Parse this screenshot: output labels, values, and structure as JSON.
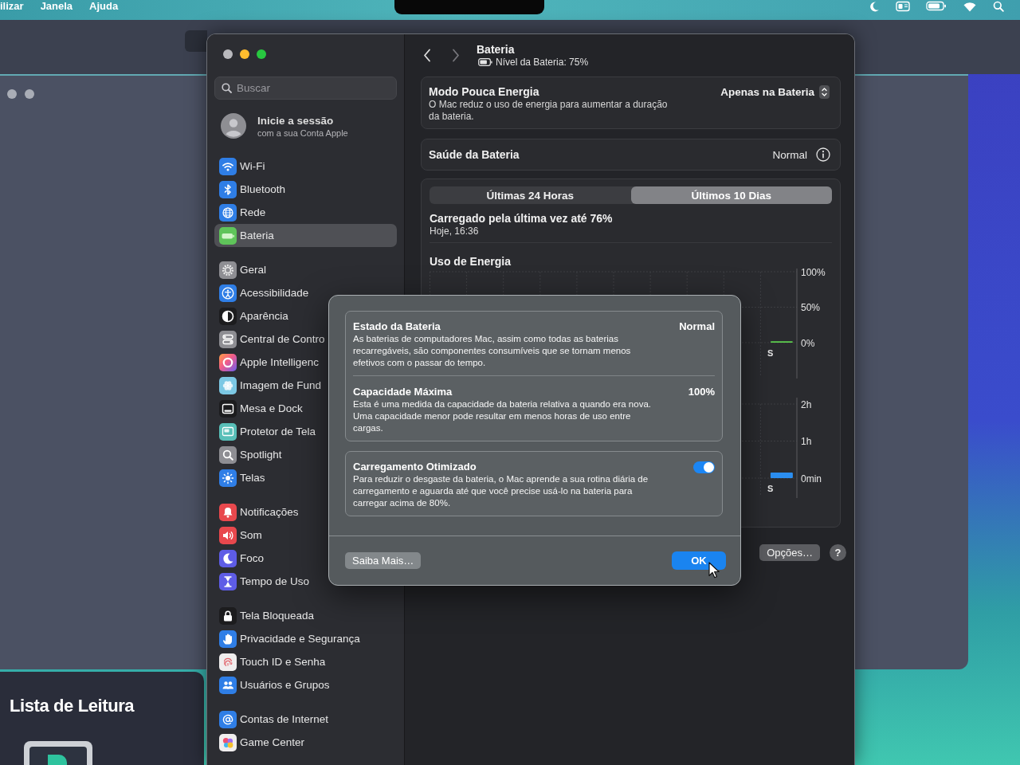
{
  "menu_bar": {
    "menus": [
      "ilizar",
      "Janela",
      "Ajuda"
    ]
  },
  "reading_list": {
    "title": "Lista de Leitura"
  },
  "settings": {
    "traffic_lights": [
      {
        "kind": "close",
        "disabled": true
      },
      {
        "kind": "minimize",
        "disabled": false
      },
      {
        "kind": "zoom",
        "disabled": false
      }
    ],
    "sidebar": {
      "search": {
        "placeholder": "Buscar"
      },
      "account": {
        "title": "Inicie a sessão",
        "subtitle": "com a sua Conta Apple"
      },
      "groups": [
        {
          "items": [
            {
              "label": "Wi-Fi",
              "selected": false
            },
            {
              "label": "Bluetooth",
              "selected": false
            },
            {
              "label": "Rede",
              "selected": false
            },
            {
              "label": "Bateria",
              "selected": true
            }
          ]
        },
        {
          "items": [
            {
              "label": "Geral",
              "selected": false
            },
            {
              "label": "Acessibilidade",
              "selected": false
            },
            {
              "label": "Aparência",
              "selected": false
            },
            {
              "label": "Central de Contro",
              "selected": false
            },
            {
              "label": "Apple Intelligenc",
              "selected": false
            },
            {
              "label": "Imagem de Fund",
              "selected": false
            },
            {
              "label": "Mesa e Dock",
              "selected": false
            },
            {
              "label": "Protetor de Tela",
              "selected": false
            },
            {
              "label": "Spotlight",
              "selected": false
            },
            {
              "label": "Telas",
              "selected": false
            }
          ]
        },
        {
          "items": [
            {
              "label": "Notificações",
              "selected": false
            },
            {
              "label": "Som",
              "selected": false
            },
            {
              "label": "Foco",
              "selected": false
            },
            {
              "label": "Tempo de Uso",
              "selected": false
            }
          ]
        },
        {
          "items": [
            {
              "label": "Tela Bloqueada",
              "selected": false
            },
            {
              "label": "Privacidade e Segurança",
              "selected": false
            },
            {
              "label": "Touch ID e Senha",
              "selected": false
            },
            {
              "label": "Usuários e Grupos",
              "selected": false
            }
          ]
        },
        {
          "items": [
            {
              "label": "Contas de Internet",
              "selected": false
            },
            {
              "label": "Game Center",
              "selected": false
            }
          ]
        }
      ]
    },
    "header": {
      "back": {
        "disabled": false
      },
      "forward": {
        "disabled": true
      },
      "title": "Bateria",
      "subtitle": "Nível da Bateria: 75%"
    },
    "low_power_mode": {
      "title": "Modo Pouca Energia",
      "description": "O Mac reduz o uso de energia para aumentar a duração da bateria.",
      "value": "Apenas na Bateria"
    },
    "battery_health": {
      "title": "Saúde da Bateria",
      "value": "Normal"
    },
    "usage": {
      "tabs": [
        {
          "label": "Últimas 24 Horas",
          "selected": false
        },
        {
          "label": "Últimos 10 Dias",
          "selected": true
        }
      ],
      "last_charged": {
        "title": "Carregado pela última vez até 76%",
        "time": "Hoje, 16:36"
      },
      "heading": "Uso de Energia",
      "charts": [
        {
          "chart_data": {
            "type": "bar",
            "categories": [
              "S"
            ],
            "values": [
              2
            ],
            "ylim": [
              0,
              100
            ],
            "yticks": [
              {
                "value": 0,
                "label": "0%"
              },
              {
                "value": 50,
                "label": "50%"
              },
              {
                "value": 100,
                "label": "100%"
              }
            ]
          }
        },
        {
          "chart_data": {
            "type": "bar",
            "categories": [
              "S"
            ],
            "values": [
              0.15
            ],
            "ylim": [
              0,
              2
            ],
            "yticks": [
              {
                "value": 0,
                "label": "0min"
              },
              {
                "value": 1,
                "label": "1h"
              },
              {
                "value": 2,
                "label": "2h"
              }
            ]
          }
        }
      ]
    },
    "buttons": [
      {
        "kind": "text",
        "label": "Opções…"
      },
      {
        "kind": "help",
        "label": "?"
      }
    ]
  },
  "dialog": {
    "sections": [
      {
        "rows": [
          {
            "kind": "value",
            "title": "Estado da Bateria",
            "value": "Normal",
            "description": "As baterias de computadores Mac, assim como todas as baterias recarregáveis, são componentes consumíveis que se tornam menos efetivos com o passar do tempo."
          },
          {
            "kind": "value",
            "title": "Capacidade Máxima",
            "value": "100%",
            "description": "Esta é uma medida da capacidade da bateria relativa a quando era nova. Uma capacidade menor pode resultar em menos horas de uso entre cargas."
          }
        ]
      },
      {
        "rows": [
          {
            "kind": "toggle",
            "title": "Carregamento Otimizado",
            "on": true,
            "description": "Para reduzir o desgaste da bateria, o Mac aprende a sua rotina diária de carregamento e aguarda até que você precise usá-lo na bateria para carregar acima de 80%."
          }
        ]
      }
    ],
    "buttons": [
      {
        "kind": "secondary",
        "label": "Saiba Mais…"
      },
      {
        "kind": "default",
        "label": "OK"
      }
    ]
  }
}
